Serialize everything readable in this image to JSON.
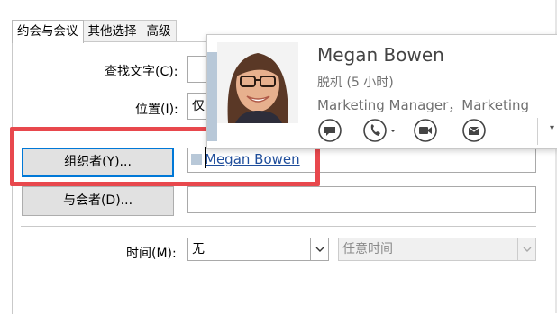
{
  "tabs": [
    {
      "label": "约会与会议",
      "active": true
    },
    {
      "label": "其他选择",
      "active": false
    },
    {
      "label": "高级",
      "active": false
    }
  ],
  "form": {
    "find_label": "查找文字(C):",
    "find_value": "",
    "location_label": "位置(I):",
    "location_value": "仅",
    "organizer_button": "组织者(Y)...",
    "organizer_value": "Megan Bowen",
    "attendees_button": "与会者(D)...",
    "attendees_value": "",
    "time_label": "时间(M):",
    "time_value": "无",
    "time_range_value": "任意时间"
  },
  "contact_card": {
    "name": "Megan Bowen",
    "status": "脱机 (5 小时)",
    "title": "Marketing Manager，Marketing",
    "actions": [
      "chat-icon",
      "phone-icon",
      "video-icon",
      "mail-icon"
    ]
  },
  "colors": {
    "highlight": "#e8484d",
    "link": "#1f4e9c",
    "focus": "#0078d7",
    "presence": "#b8c8d8"
  }
}
